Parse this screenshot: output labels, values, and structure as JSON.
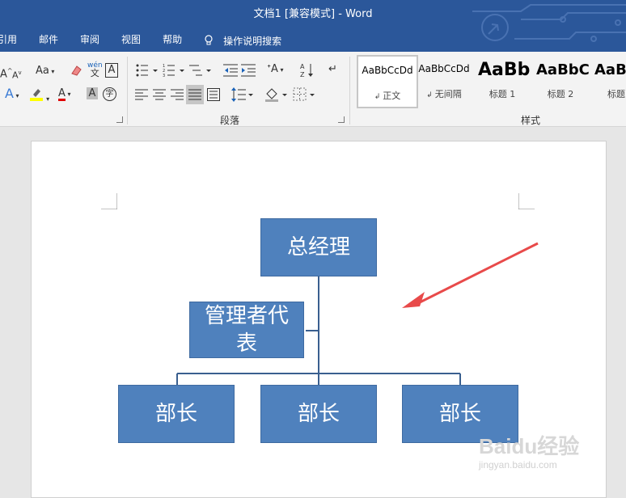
{
  "window": {
    "title": "文档1 [兼容模式] - Word"
  },
  "tabs": [
    {
      "label": "引用"
    },
    {
      "label": "邮件"
    },
    {
      "label": "审阅"
    },
    {
      "label": "视图"
    },
    {
      "label": "帮助"
    }
  ],
  "search": {
    "label": "操作说明搜索"
  },
  "ribbon": {
    "font_group": {
      "aa_label": "Aa",
      "phonetic_top": "wén",
      "phonetic_bottom": "文",
      "box_a": "A",
      "highlight_color": "#ffff00",
      "font_color": "#e00000",
      "char_shade": "A",
      "enclose": "字"
    },
    "paragraph_group": {
      "label": "段落"
    },
    "styles_group": {
      "label": "样式",
      "styles": [
        {
          "preview": "AaBbCcDd",
          "name": "正文",
          "selected": true
        },
        {
          "preview": "AaBbCcDd",
          "name": "无间隔",
          "selected": false
        },
        {
          "preview": "AaBb",
          "name": "标题 1",
          "selected": false
        },
        {
          "preview": "AaBbC",
          "name": "标题 2",
          "selected": false
        },
        {
          "preview": "AaBl",
          "name": "标题",
          "selected": false
        }
      ]
    }
  },
  "document": {
    "org_chart": {
      "box_color": "#4f81bd",
      "line_color": "#3a5f8f",
      "top": "总经理",
      "assistant": "管理者代表",
      "subordinates": [
        "部长",
        "部长",
        "部长"
      ]
    },
    "arrow_color": "#e84a4a"
  },
  "watermark": {
    "main": "Baidu经验",
    "sub": "jingyan.baidu.com"
  }
}
